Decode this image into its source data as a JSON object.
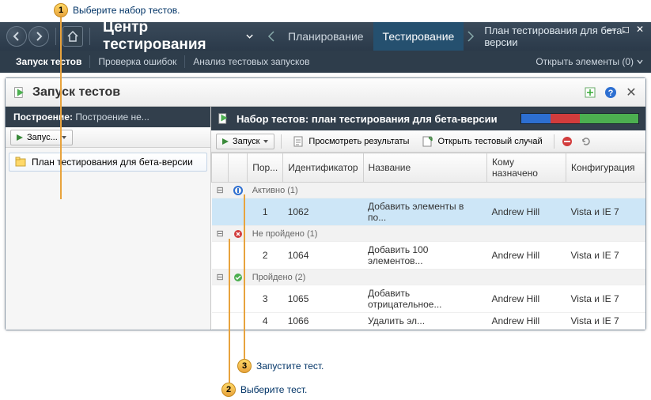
{
  "callouts": {
    "c1": "Выберите набор тестов.",
    "c2": "Выберите тест.",
    "c3": "Запустите тест."
  },
  "window": {
    "app_title": "Центр тестирования",
    "plan_label": "План тестирования для бета-версии"
  },
  "main_tabs": {
    "planning": "Планирование",
    "testing": "Тестирование"
  },
  "subbar": {
    "run_tests": "Запуск тестов",
    "verify_bugs": "Проверка ошибок",
    "analyze_runs": "Анализ тестовых запусков",
    "open_items": "Открыть элементы (0)"
  },
  "panel": {
    "title": "Запуск тестов",
    "build_label": "Построение:",
    "build_value": "Построение не..."
  },
  "left": {
    "run_btn": "Запус...",
    "tree_item": "План тестирования для бета-версии"
  },
  "suite": {
    "title_prefix": "Набор тестов:",
    "title_value": "план тестирования для бета-версии"
  },
  "toolbar": {
    "run": "Запуск",
    "view_results": "Просмотреть результаты",
    "open_test_case": "Открыть тестовый случай"
  },
  "columns": {
    "order": "Пор...",
    "id": "Идентификатор",
    "title": "Название",
    "assigned": "Кому назначено",
    "config": "Конфигурация"
  },
  "groups": {
    "active": "Активно (1)",
    "failed": "Не пройдено (1)",
    "passed": "Пройдено (2)"
  },
  "rows": {
    "r1": {
      "n": "1",
      "id": "1062",
      "title": "Добавить элементы в по...",
      "assigned": "Andrew Hill",
      "config": "Vista и IE 7"
    },
    "r2": {
      "n": "2",
      "id": "1064",
      "title": "Добавить 100 элементов...",
      "assigned": "Andrew Hill",
      "config": "Vista и IE 7"
    },
    "r3": {
      "n": "3",
      "id": "1065",
      "title": "Добавить отрицательное...",
      "assigned": "Andrew Hill",
      "config": "Vista и IE 7"
    },
    "r4": {
      "n": "4",
      "id": "1066",
      "title": "Удалить эл...",
      "assigned": "Andrew Hill",
      "config": "Vista и IE 7"
    }
  },
  "progress": {
    "active_color": "#2d6fd1",
    "failed_color": "#d23c3c",
    "passed_color": "#4caf50",
    "active_pct": 25,
    "failed_pct": 25,
    "passed_pct": 50
  }
}
